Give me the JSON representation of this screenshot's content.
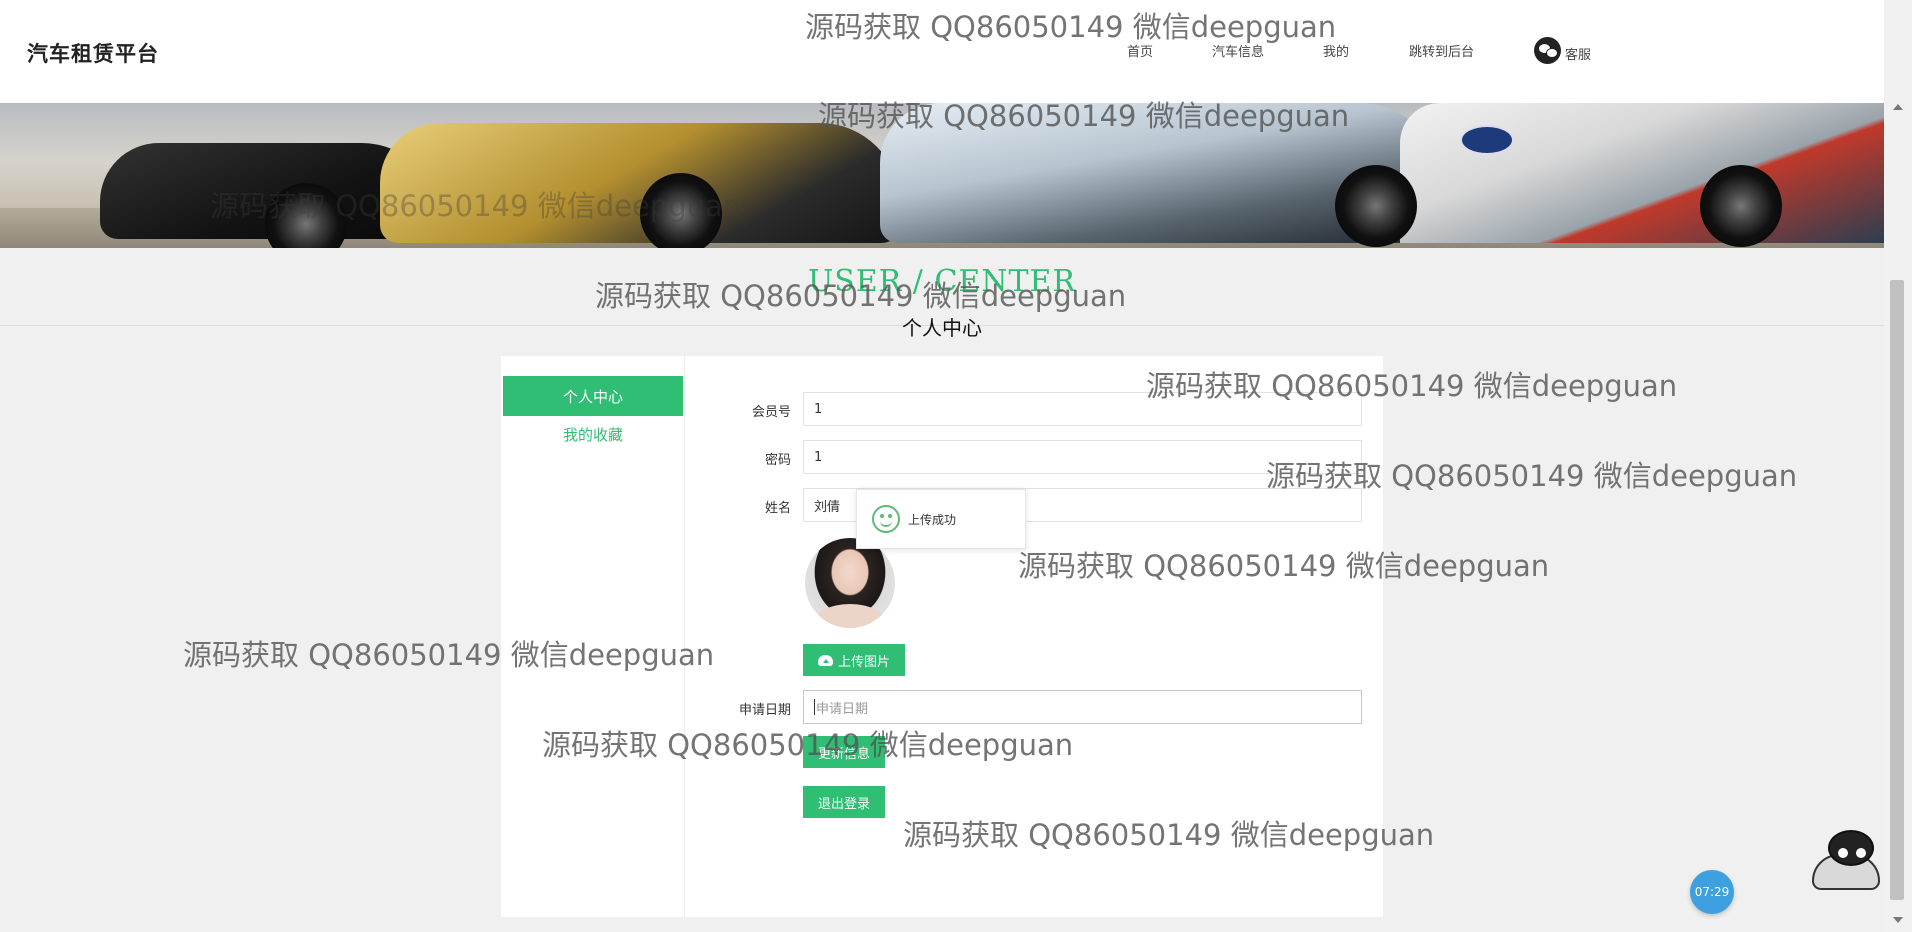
{
  "header": {
    "brand": "汽车租赁平台",
    "nav": [
      "首页",
      "汽车信息",
      "我的",
      "跳转到后台"
    ],
    "service_label": "客服"
  },
  "section": {
    "title_en": "USER / CENTER",
    "title_cn": "个人中心"
  },
  "sidebar": {
    "items": [
      {
        "label": "个人中心",
        "active": true
      },
      {
        "label": "我的收藏",
        "active": false
      }
    ]
  },
  "form": {
    "member_no_label": "会员号",
    "member_no_value": "1",
    "password_label": "密码",
    "password_value": "1",
    "name_label": "姓名",
    "name_value": "刘倩",
    "upload_button": "上传图片",
    "apply_date_label": "申请日期",
    "apply_date_placeholder": "申请日期",
    "update_button": "更新信息",
    "logout_button": "退出登录"
  },
  "toast": {
    "message": "上传成功"
  },
  "clock": "07:29",
  "watermark_text": "源码获取 QQ86050149 微信deepguan",
  "colors": {
    "accent": "#2fbe74",
    "clock_bubble": "#3fa0e0"
  },
  "icons": [
    "wechat-icon",
    "cloud-upload-icon",
    "smile-icon",
    "cat-mascot"
  ]
}
